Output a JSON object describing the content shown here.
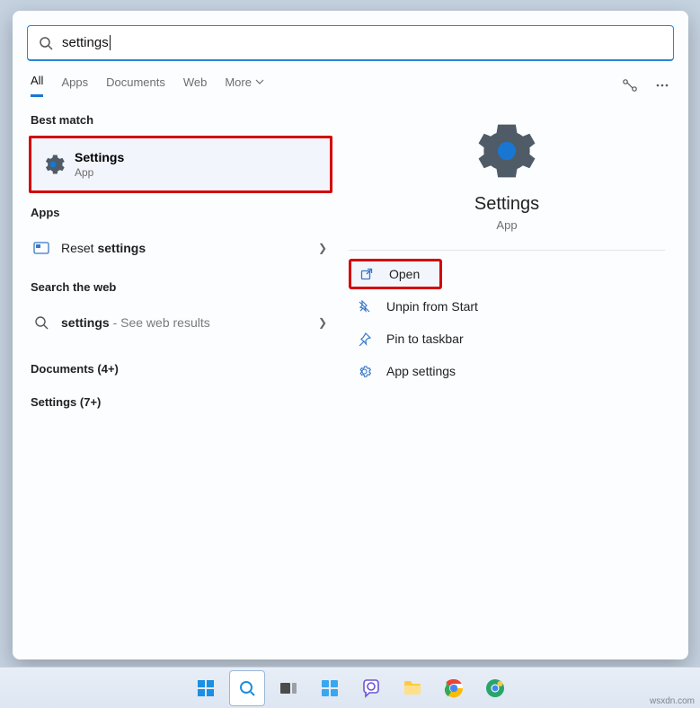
{
  "search": {
    "query": "settings"
  },
  "tabs": {
    "items": [
      {
        "label": "All",
        "active": true
      },
      {
        "label": "Apps"
      },
      {
        "label": "Documents"
      },
      {
        "label": "Web"
      },
      {
        "label": "More"
      }
    ]
  },
  "left": {
    "best_match_header": "Best match",
    "best_match": {
      "title": "Settings",
      "subtitle": "App"
    },
    "apps_header": "Apps",
    "apps": [
      {
        "prefix": "Reset ",
        "bold": "settings"
      }
    ],
    "web_header": "Search the web",
    "web": [
      {
        "bold": "settings",
        "suffix": " - See web results"
      }
    ],
    "documents_header": "Documents (4+)",
    "settings_header": "Settings (7+)"
  },
  "preview": {
    "title": "Settings",
    "subtitle": "App",
    "actions": [
      {
        "key": "open",
        "label": "Open",
        "icon": "open-external-icon",
        "highlighted": true
      },
      {
        "key": "unpin",
        "label": "Unpin from Start",
        "icon": "unpin-icon"
      },
      {
        "key": "pin-taskbar",
        "label": "Pin to taskbar",
        "icon": "pin-icon"
      },
      {
        "key": "app-settings",
        "label": "App settings",
        "icon": "gear-icon"
      }
    ]
  },
  "taskbar": {
    "watermark": "wsxdn.com",
    "items": [
      {
        "name": "start",
        "icon": "windows-icon"
      },
      {
        "name": "search",
        "icon": "search-icon",
        "active": true
      },
      {
        "name": "taskview",
        "icon": "taskview-icon"
      },
      {
        "name": "widgets",
        "icon": "widgets-icon"
      },
      {
        "name": "chat",
        "icon": "chat-icon"
      },
      {
        "name": "explorer",
        "icon": "folder-icon"
      },
      {
        "name": "chrome",
        "icon": "chrome-icon"
      },
      {
        "name": "chrome-canary",
        "icon": "chrome-canary-icon"
      }
    ]
  }
}
